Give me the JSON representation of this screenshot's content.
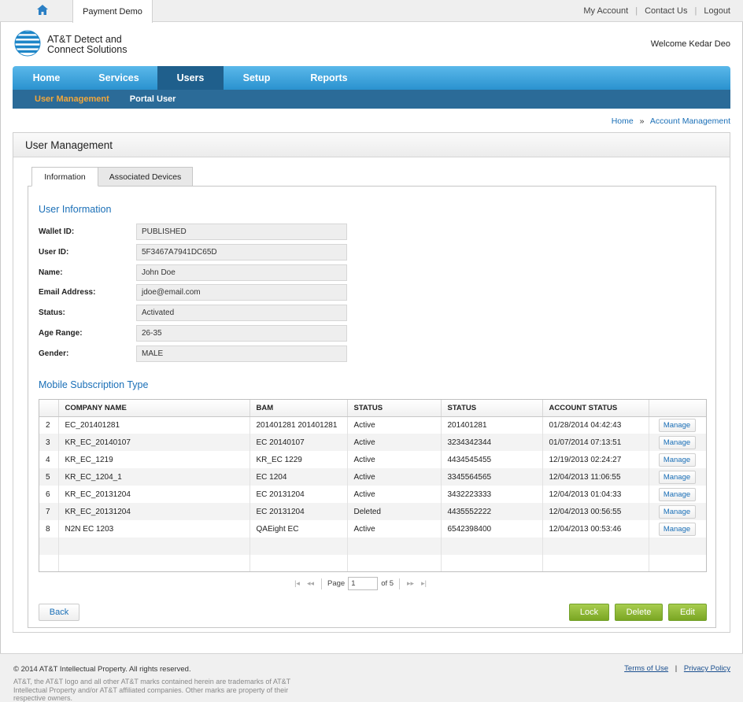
{
  "topbar": {
    "app_tab": "Payment Demo",
    "links": [
      "My Account",
      "Contact Us",
      "Logout"
    ]
  },
  "header": {
    "logo_line1": "AT&T Detect and",
    "logo_line2": "Connect Solutions",
    "welcome": "Welcome Kedar Deo"
  },
  "nav": {
    "items": [
      "Home",
      "Services",
      "Users",
      "Setup",
      "Reports"
    ],
    "active": "Users",
    "sub_items": [
      "User Management",
      "Portal User"
    ]
  },
  "breadcrumb": [
    "Home",
    "Account Management"
  ],
  "panel": {
    "title": "User Management",
    "tabs": [
      "Information",
      "Associated Devices"
    ]
  },
  "user_info": {
    "title": "User Information",
    "fields": [
      {
        "label": "Wallet ID:",
        "value": "PUBLISHED"
      },
      {
        "label": "User ID:",
        "value": "5F3467A7941DC65D"
      },
      {
        "label": "Name:",
        "value": "John Doe"
      },
      {
        "label": "Email Address:",
        "value": "jdoe@email.com"
      },
      {
        "label": "Status:",
        "value": "Activated"
      },
      {
        "label": "Age Range:",
        "value": "26-35"
      },
      {
        "label": "Gender:",
        "value": "MALE"
      }
    ]
  },
  "subscriptions": {
    "title": "Mobile Subscription Type",
    "columns": [
      "",
      "COMPANY NAME",
      "BAM",
      "STATUS",
      "STATUS",
      "ACCOUNT STATUS",
      ""
    ],
    "manage_label": "Manage",
    "rows": [
      [
        "2",
        "EC_201401281",
        "201401281 201401281",
        "Active",
        "201401281",
        "01/28/2014 04:42:43"
      ],
      [
        "3",
        "KR_EC_20140107",
        "EC 20140107",
        "Active",
        "3234342344",
        "01/07/2014 07:13:51"
      ],
      [
        "4",
        "KR_EC_1219",
        "KR_EC 1229",
        "Active",
        "4434545455",
        "12/19/2013 02:24:27"
      ],
      [
        "5",
        "KR_EC_1204_1",
        "EC 1204",
        "Active",
        "3345564565",
        "12/04/2013 11:06:55"
      ],
      [
        "6",
        "KR_EC_20131204",
        "EC 20131204",
        "Active",
        "3432223333",
        "12/04/2013 01:04:33"
      ],
      [
        "7",
        "KR_EC_20131204",
        "EC 20131204",
        "Deleted",
        "4435552222",
        "12/04/2013 00:56:55"
      ],
      [
        "8",
        "N2N EC 1203",
        "QAEight EC",
        "Active",
        "6542398400",
        "12/04/2013 00:53:46"
      ]
    ]
  },
  "pager": {
    "page_label": "Page",
    "page_value": "1",
    "of_label": "of 5"
  },
  "buttons": {
    "back": "Back",
    "lock": "Lock",
    "delete": "Delete",
    "edit": "Edit"
  },
  "footer": {
    "copyright": "© 2014 AT&T Intellectual Property. All rights reserved.",
    "legal": "AT&T, the AT&T logo and all other AT&T marks contained herein are trademarks of AT&T Intellectual Property and/or AT&T affiliated companies. Other marks are property of their respective owners.",
    "links": [
      "Terms of Use",
      "Privacy Policy"
    ]
  },
  "colors": {
    "nav_blue": "#2a92cf",
    "nav_active": "#1f5f8c",
    "sub_active": "#f3a73a",
    "link_blue": "#1a6fb7",
    "button_green": "#8ab93a"
  }
}
